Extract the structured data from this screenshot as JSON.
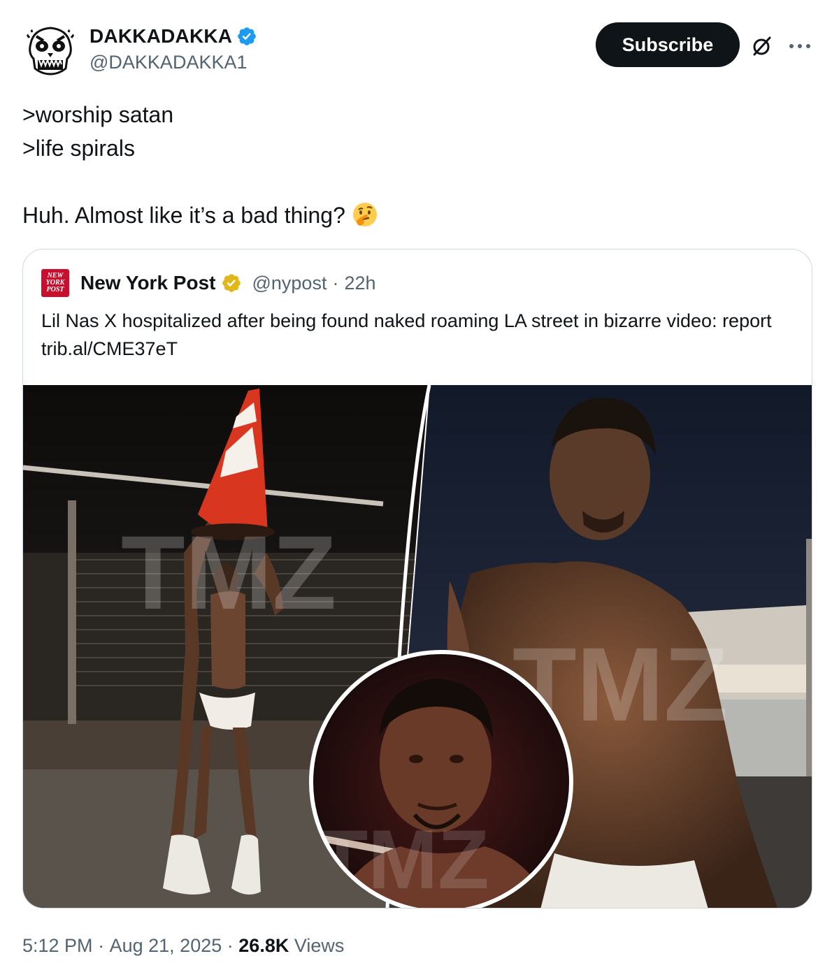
{
  "author": {
    "display_name": "DAKKADAKKA",
    "handle": "@DAKKADAKKA1",
    "avatar_icon": "ork-skull-avatar",
    "verified_color": "#1d9bf0"
  },
  "actions": {
    "subscribe_label": "Subscribe",
    "grok_icon": "grok-icon",
    "more_icon": "more-icon"
  },
  "tweet": {
    "lines": [
      ">worship satan",
      ">life spirals"
    ],
    "closing": "Huh. Almost like it’s a bad thing?",
    "emoji": "thinking-face-emoji"
  },
  "quoted_tweet": {
    "source_name": "New York Post",
    "logo_text": [
      "NEW",
      "YORK",
      "POST"
    ],
    "handle": "@nypost",
    "separator": "·",
    "age": "22h",
    "text": "Lil Nas X hospitalized after being found naked roaming LA street in bizarre video: report trib.al/CME37eT",
    "media_description_icon": "news-photo-collage",
    "watermark": "TMZ",
    "verified_color": "#e2b719"
  },
  "footer": {
    "time": "5:12 PM",
    "separator": "·",
    "date": "Aug 21, 2025",
    "views_count": "26.8K",
    "views_label": "Views"
  },
  "colors": {
    "text": "#0f1419",
    "muted": "#536471",
    "border": "#cfd9de",
    "nyp_red": "#c8102e"
  }
}
